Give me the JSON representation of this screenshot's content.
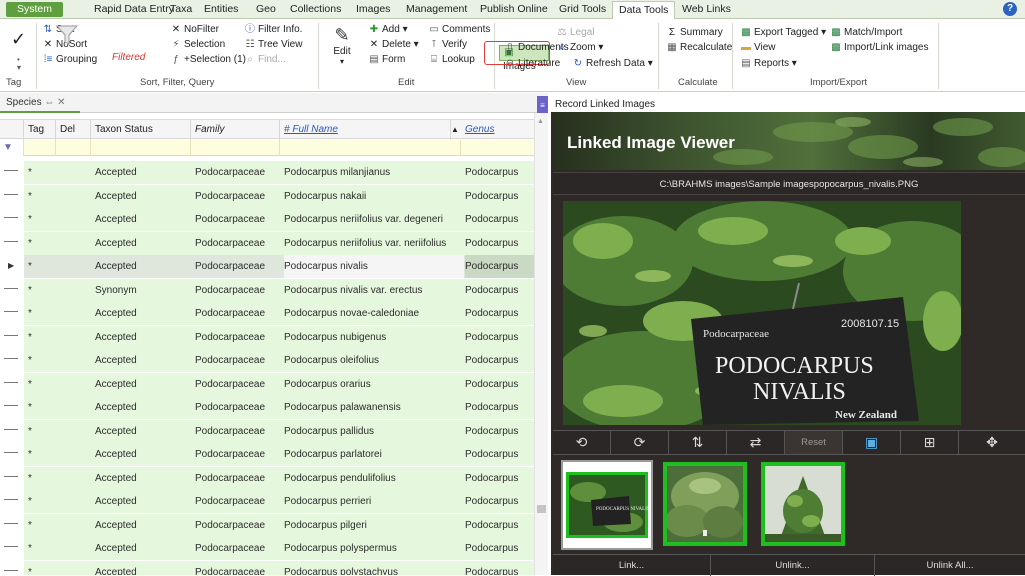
{
  "menu_tabs": [
    "System",
    "Rapid Data Entry",
    "Taxa",
    "Entities",
    "Geo",
    "Collections",
    "Images",
    "Management",
    "Publish Online",
    "Grid Tools",
    "Data Tools",
    "Web Links"
  ],
  "active_tab": "Data Tools",
  "ribbon": {
    "tag_group": {
      "label": "Tag"
    },
    "sort_group": {
      "label": "Sort, Filter, Query",
      "sort": "Sort",
      "nosort": "NoSort",
      "grouping": "Grouping",
      "filtered": "Filtered",
      "nofilter": "NoFilter",
      "selection": "Selection",
      "plus_selection": "+Selection (1)",
      "filter_info": "Filter Info.",
      "tree_view": "Tree View",
      "find": "Find..."
    },
    "edit_group": {
      "label": "Edit",
      "edit": "Edit",
      "add": "Add",
      "delete": "Delete",
      "form": "Form",
      "comments": "Comments",
      "verify": "Verify",
      "lookup": "Lookup"
    },
    "view_group": {
      "label": "View",
      "images": "Images",
      "legal": "Legal",
      "documents": "Documents",
      "zoom": "Zoom",
      "literature": "Literature",
      "refresh_data": "Refresh Data"
    },
    "calculate_group": {
      "label": "Calculate",
      "summary": "Summary",
      "recalculate": "Recalculate"
    },
    "import_group": {
      "label": "Import/Export",
      "export_tagged": "Export Tagged",
      "view": "View",
      "reports": "Reports",
      "match_import": "Match/Import",
      "import_link_images": "Import/Link images"
    }
  },
  "species_panel": {
    "tab_label": "Species",
    "columns": [
      "Tag",
      "Del",
      "Taxon Status",
      "Family",
      "# Full Name",
      "Genus"
    ],
    "rows": [
      {
        "tag": "*",
        "status": "Accepted",
        "family": "Podocarpaceae",
        "full_name": "Podocarpus milanjianus",
        "genus": "Podocarpus"
      },
      {
        "tag": "*",
        "status": "Accepted",
        "family": "Podocarpaceae",
        "full_name": "Podocarpus nakaii",
        "genus": "Podocarpus"
      },
      {
        "tag": "*",
        "status": "Accepted",
        "family": "Podocarpaceae",
        "full_name": "Podocarpus neriifolius var. degeneri",
        "genus": "Podocarpus"
      },
      {
        "tag": "*",
        "status": "Accepted",
        "family": "Podocarpaceae",
        "full_name": "Podocarpus neriifolius var. neriifolius",
        "genus": "Podocarpus"
      },
      {
        "tag": "*",
        "status": "Accepted",
        "family": "Podocarpaceae",
        "full_name": "Podocarpus nivalis",
        "genus": "Podocarpus"
      },
      {
        "tag": "*",
        "status": "Synonym",
        "family": "Podocarpaceae",
        "full_name": "Podocarpus nivalis var. erectus",
        "genus": "Podocarpus"
      },
      {
        "tag": "*",
        "status": "Accepted",
        "family": "Podocarpaceae",
        "full_name": "Podocarpus novae-caledoniae",
        "genus": "Podocarpus"
      },
      {
        "tag": "*",
        "status": "Accepted",
        "family": "Podocarpaceae",
        "full_name": "Podocarpus nubigenus",
        "genus": "Podocarpus"
      },
      {
        "tag": "*",
        "status": "Accepted",
        "family": "Podocarpaceae",
        "full_name": "Podocarpus oleifolius",
        "genus": "Podocarpus"
      },
      {
        "tag": "*",
        "status": "Accepted",
        "family": "Podocarpaceae",
        "full_name": "Podocarpus orarius",
        "genus": "Podocarpus"
      },
      {
        "tag": "*",
        "status": "Accepted",
        "family": "Podocarpaceae",
        "full_name": "Podocarpus palawanensis",
        "genus": "Podocarpus"
      },
      {
        "tag": "*",
        "status": "Accepted",
        "family": "Podocarpaceae",
        "full_name": "Podocarpus pallidus",
        "genus": "Podocarpus"
      },
      {
        "tag": "*",
        "status": "Accepted",
        "family": "Podocarpaceae",
        "full_name": "Podocarpus parlatorei",
        "genus": "Podocarpus"
      },
      {
        "tag": "*",
        "status": "Accepted",
        "family": "Podocarpaceae",
        "full_name": "Podocarpus pendulifolius",
        "genus": "Podocarpus"
      },
      {
        "tag": "*",
        "status": "Accepted",
        "family": "Podocarpaceae",
        "full_name": "Podocarpus perrieri",
        "genus": "Podocarpus"
      },
      {
        "tag": "*",
        "status": "Accepted",
        "family": "Podocarpaceae",
        "full_name": "Podocarpus pilgeri",
        "genus": "Podocarpus"
      },
      {
        "tag": "*",
        "status": "Accepted",
        "family": "Podocarpaceae",
        "full_name": "Podocarpus polyspermus",
        "genus": "Podocarpus"
      },
      {
        "tag": "*",
        "status": "Accepted",
        "family": "Podocarpaceae",
        "full_name": "Podocarpus polystachyus",
        "genus": "Podocarpus"
      }
    ],
    "selected_row": 4
  },
  "image_panel": {
    "header": "Record Linked Images",
    "title": "Linked Image Viewer",
    "path": "C:\\BRAHMS images\\Sample imagespopocarpus_nivalis.PNG",
    "sign": {
      "family": "Podocarpaceae",
      "number": "2008107.15",
      "genus": "PODOCARPUS",
      "species": "NIVALIS",
      "country": "New Zealand"
    },
    "reset_label": "Reset",
    "thumb_sign_text": "PODOCARPUS NIVALIS",
    "link_label": "Link...",
    "unlink_label": "Unlink...",
    "unlink_all_label": "Unlink All..."
  },
  "colors": {
    "accent_green": "#5f9f3f",
    "row_green": "#e5f7dc",
    "thumb_border": "#1fbf1f",
    "highlight_red": "#e23b3b"
  }
}
